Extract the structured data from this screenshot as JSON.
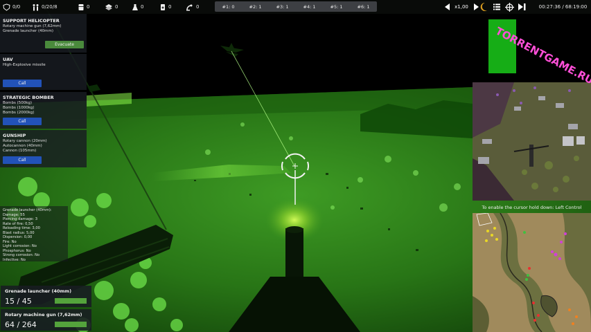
{
  "top_bar": {
    "units": "0/0",
    "soldiers": "0/20/8",
    "res1": "0",
    "res2": "0",
    "res3": "0",
    "res4": "0",
    "res5": "0",
    "missions": [
      "#1: 0",
      "#2: 1",
      "#3: 1",
      "#4: 1",
      "#5: 1",
      "#6: 1"
    ],
    "speed": "x1,00",
    "clock": "00:27:36 / 68:19:00"
  },
  "support": {
    "helicopter": {
      "title": "SUPPORT HELICOPTER",
      "weapons": [
        "Rotary machine gun (7,62mm)",
        "Grenade launcher (40mm)"
      ],
      "button": "Evacuate"
    },
    "uav": {
      "title": "UAV",
      "weapons": [
        "High-Explosive missile"
      ],
      "button": "Call"
    },
    "bomber": {
      "title": "STRATEGIC BOMBER",
      "weapons": [
        "Bombs (500kg)",
        "Bombs (1000kg)",
        "Bombs (2000kg)"
      ],
      "button": "Call"
    },
    "gunship": {
      "title": "GUNSHIP",
      "weapons": [
        "Rotary cannon (20mm)",
        "Autocannon (40mm)",
        "Cannon (105mm)"
      ],
      "button": "Call"
    }
  },
  "weapon_stats": [
    "Grenade launcher (40mm):",
    "Damage: 55",
    "Piercing damage: 3",
    "Rate of fire: 0,50",
    "Reloading time: 3,00",
    "Blast radius: 5,00",
    "Dispersion: 0,00",
    "Fire: No",
    "Light corrosion: No",
    "Phosphorus: No",
    "Strong corrosion: No",
    "Infective: No"
  ],
  "ammo": [
    {
      "name": "Grenade launcher (40mm)",
      "count": "15 / 45",
      "level": 1.0
    },
    {
      "name": "Rotary machine gun (7,62mm)",
      "count": "64 / 264",
      "level": 1.0
    }
  ],
  "cursor_hint": "To enable the cursor hold down:  Left Control",
  "watermark": "TORRENTGAME.RU",
  "colors": {
    "night_vision": "#1f7a14",
    "button_green": "#4a8a3c",
    "button_blue": "#2252b8",
    "ammo_fill": "#54a33c"
  }
}
